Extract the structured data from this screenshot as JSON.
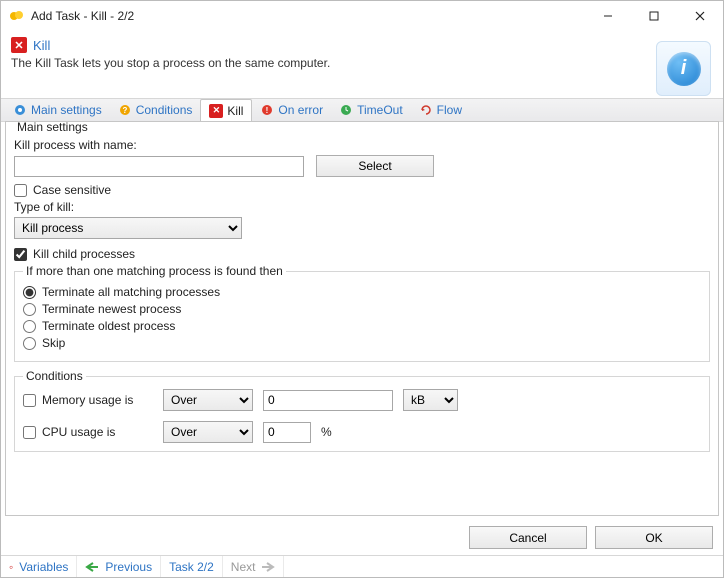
{
  "window": {
    "title": "Add Task - Kill - 2/2"
  },
  "header": {
    "title": "Kill",
    "subtitle": "The Kill Task lets you stop a process on the same computer."
  },
  "tabs": [
    {
      "id": "main",
      "label": "Main settings"
    },
    {
      "id": "cond",
      "label": "Conditions"
    },
    {
      "id": "kill",
      "label": "Kill"
    },
    {
      "id": "err",
      "label": "On error"
    },
    {
      "id": "to",
      "label": "TimeOut"
    },
    {
      "id": "flow",
      "label": "Flow"
    }
  ],
  "form": {
    "group_main": "Main settings",
    "process_name_label": "Kill process with name:",
    "process_name_value": "",
    "select_btn": "Select",
    "case_sensitive_label": "Case sensitive",
    "case_sensitive_checked": false,
    "type_label": "Type of kill:",
    "type_value": "Kill process",
    "kill_child_label": "Kill child processes",
    "kill_child_checked": true,
    "multi_group": "If more than one matching process is found then",
    "multi_options": [
      {
        "label": "Terminate all matching processes",
        "checked": true
      },
      {
        "label": "Terminate newest process",
        "checked": false
      },
      {
        "label": "Terminate oldest process",
        "checked": false
      },
      {
        "label": "Skip",
        "checked": false
      }
    ],
    "cond_group": "Conditions",
    "mem_label": "Memory usage is",
    "mem_checked": false,
    "mem_op": "Over",
    "mem_val": "0",
    "mem_unit": "kB",
    "cpu_label": "CPU usage is",
    "cpu_checked": false,
    "cpu_op": "Over",
    "cpu_val": "0",
    "cpu_unit": "%"
  },
  "buttons": {
    "cancel": "Cancel",
    "ok": "OK"
  },
  "status": {
    "variables": "Variables",
    "prev": "Previous",
    "task": "Task 2/2",
    "next": "Next"
  }
}
